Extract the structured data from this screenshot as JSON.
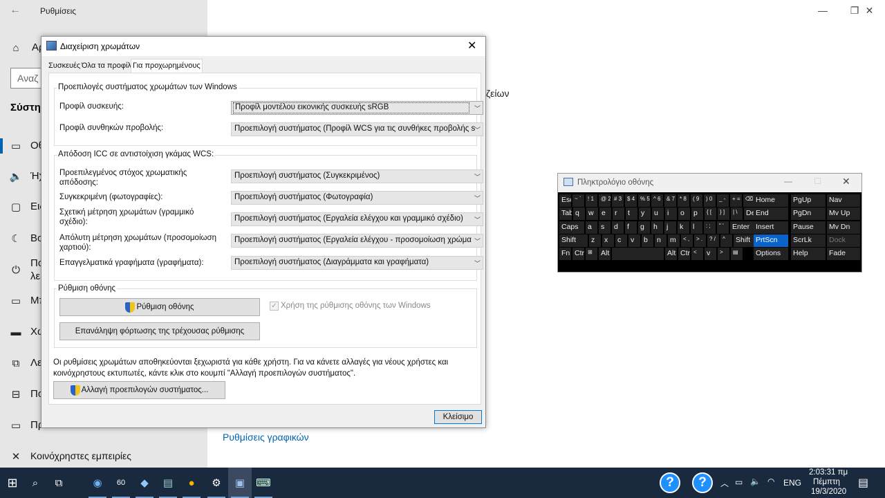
{
  "settings": {
    "title": "Ρυθμίσεις",
    "home_partial": "Αρ",
    "search_partial": "Αναζ",
    "section_partial": "Σύστη",
    "nav_partials": [
      "Οθ",
      "Ήχ",
      "Ειδ",
      "Βο",
      "Πο",
      "λε",
      "Μπ",
      "Χω",
      "Λε",
      "Πο",
      "Πρ"
    ],
    "shared_experiences": "Κοινόχρηστες εμπειρίες",
    "right_partial": "ζείων",
    "graphics_link": "Ρυθμίσεις γραφικών"
  },
  "dialog": {
    "title": "Διαχείριση χρωμάτων",
    "tabs": [
      "Συσκευές",
      "Όλα τα προφίλ",
      "Για προχωρημένους"
    ],
    "group_windows": {
      "title": "Προεπιλογές συστήματος χρωμάτων των Windows",
      "rows": [
        {
          "label": "Προφίλ συσκευής:",
          "value": "Προφίλ μοντέλου εικονικής συσκευής sRGB"
        },
        {
          "label": "Προφίλ συνθηκών προβολής:",
          "value": "Προεπιλογή συστήματος (Προφίλ WCS για τις συνθήκες προβολής s"
        }
      ]
    },
    "group_icc": {
      "title": "Απόδοση ICC σε αντιστοίχιση γκάμας WCS:",
      "rows": [
        {
          "label": "Προεπιλεγμένος στόχος χρωματικής απόδοσης:",
          "value": "Προεπιλογή συστήματος (Συγκεκριμένος)"
        },
        {
          "label": "Συγκεκριμένη (φωτογραφίες):",
          "value": "Προεπιλογή συστήματος (Φωτογραφία)"
        },
        {
          "label": "Σχετική μέτρηση χρωμάτων (γραμμικό σχέδιο):",
          "value": "Προεπιλογή συστήματος (Εργαλεία ελέγχου και γραμμικό σχέδιο)"
        },
        {
          "label": "Απόλυτη μέτρηση χρωμάτων (προσομοίωση χαρτιού):",
          "value": "Προεπιλογή συστήματος (Εργαλεία ελέγχου - προσομοίωση χρώμα"
        },
        {
          "label": "Επαγγελματικά γραφήματα (γραφήματα):",
          "value": "Προεπιλογή συστήματος (Διαγράμματα και γραφήματα)"
        }
      ]
    },
    "group_display": {
      "title": "Ρύθμιση οθόνης",
      "calibrate_button": "Ρύθμιση οθόνης",
      "reload_button": "Επανάληψη φόρτωσης της τρέχουσας ρύθμισης",
      "checkbox_label": "Χρήση της ρύθμισης οθόνης των Windows"
    },
    "info_text": "Οι ρυθμίσεις χρωμάτων αποθηκεύονται ξεχωριστά για κάθε χρήστη. Για να κάνετε αλλαγές για νέους χρήστες και κοινόχρηστους εκτυπωτές, κάντε κλικ στο κουμπί \"Αλλαγή προεπιλογών συστήματος\".",
    "change_defaults_button": "Αλλαγή προεπιλογών συστήματος...",
    "close_button": "Κλείσιμο"
  },
  "osk": {
    "title": "Πληκτρολόγιο οθόνης",
    "rows": [
      [
        "Esc",
        "~ `",
        "! 1",
        "@ 2",
        "# 3",
        "$ 4",
        "% 5",
        "^ 6",
        "& 7",
        "* 8",
        "( 9",
        ") 0",
        "_ -",
        "+ =",
        "⌫"
      ],
      [
        "Tab",
        "q",
        "w",
        "e",
        "r",
        "t",
        "y",
        "u",
        "i",
        "o",
        "p",
        "{ [",
        "} ]",
        "| \\",
        "Del"
      ],
      [
        "Caps",
        "a",
        "s",
        "d",
        "f",
        "g",
        "h",
        "j",
        "k",
        "l",
        ": ;",
        "\" '",
        "Enter"
      ],
      [
        "Shift",
        "z",
        "x",
        "c",
        "v",
        "b",
        "n",
        "m",
        "< ,",
        "> .",
        "? /",
        "^",
        "Shift"
      ],
      [
        "Fn",
        "Ctrl",
        "⊞",
        "Alt",
        "",
        "Alt",
        "Ctrl",
        "<",
        "v",
        ">",
        "▤"
      ]
    ],
    "nav_cols": [
      [
        "Home",
        "End",
        "Insert",
        "PrtScn",
        "Options"
      ],
      [
        "PgUp",
        "PgDn",
        "Pause",
        "ScrLk",
        "Help"
      ],
      [
        "Nav",
        "Mv Up",
        "Mv Dn",
        "Dock",
        "Fade"
      ]
    ]
  },
  "taskbar": {
    "language": "ENG",
    "time": "2:03:31 πμ",
    "day": "Πέμπτη",
    "date": "19/3/2020"
  }
}
